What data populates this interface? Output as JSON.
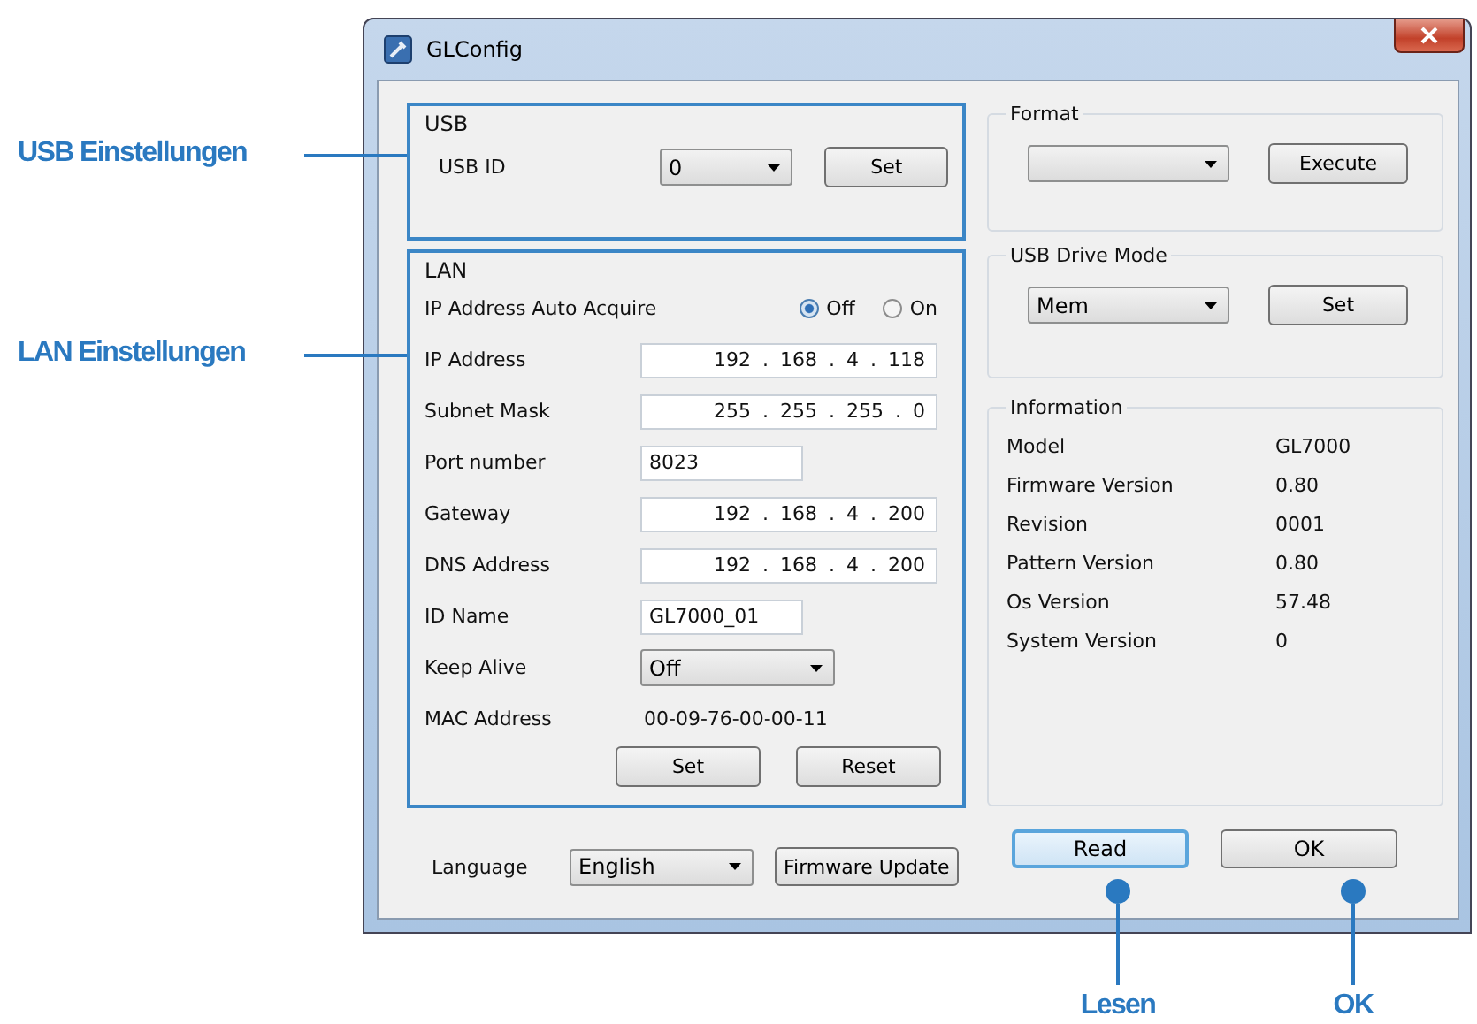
{
  "window": {
    "title": "GLConfig"
  },
  "usb_group": {
    "title": "USB",
    "usb_id_label": "USB ID",
    "usb_id_value": "0",
    "set_button": "Set"
  },
  "lan_group": {
    "title": "LAN",
    "auto_acquire": {
      "label": "IP Address Auto Acquire",
      "options": [
        {
          "label": "Off",
          "selected": true
        },
        {
          "label": "On",
          "selected": false
        }
      ]
    },
    "rows": [
      {
        "kind": "ip",
        "label": "IP Address",
        "value": "192 . 168 . 4 . 118"
      },
      {
        "kind": "ip",
        "label": "Subnet Mask",
        "value": "255 . 255 . 255 . 0"
      },
      {
        "kind": "text",
        "label": "Port number",
        "value": "8023"
      },
      {
        "kind": "ip",
        "label": "Gateway",
        "value": "192 . 168 . 4 . 200"
      },
      {
        "kind": "ip",
        "label": "DNS Address",
        "value": "192 . 168 . 4 . 200"
      },
      {
        "kind": "text",
        "label": "ID Name",
        "value": "GL7000_01"
      },
      {
        "kind": "select",
        "label": "Keep Alive",
        "value": "Off"
      },
      {
        "kind": "static",
        "label": "MAC Address",
        "value": "00-09-76-00-00-11"
      }
    ],
    "buttons": [
      "Set",
      "Reset"
    ]
  },
  "language": {
    "label": "Language",
    "value": "English"
  },
  "firmware_update_button": "Firmware Update",
  "format_group": {
    "title": "Format",
    "execute_button": "Execute"
  },
  "usb_drive_mode": {
    "title": "USB Drive Mode",
    "value": "Mem",
    "set_button": "Set"
  },
  "information": {
    "title": "Information",
    "rows": [
      {
        "label": "Model",
        "value": "GL7000"
      },
      {
        "label": "Firmware Version",
        "value": "0.80"
      },
      {
        "label": "Revision",
        "value": "0001"
      },
      {
        "label": "Pattern Version",
        "value": "0.80"
      },
      {
        "label": "Os Version",
        "value": "57.48"
      },
      {
        "label": "System Version",
        "value": "0"
      }
    ]
  },
  "dialog_buttons": [
    {
      "label": "Read",
      "focused": true
    },
    {
      "label": "OK",
      "focused": false
    }
  ],
  "side_callouts": [
    "USB Einstellungen",
    "LAN Einstellungen"
  ],
  "bottom_callouts": [
    "Lesen",
    "OK"
  ]
}
